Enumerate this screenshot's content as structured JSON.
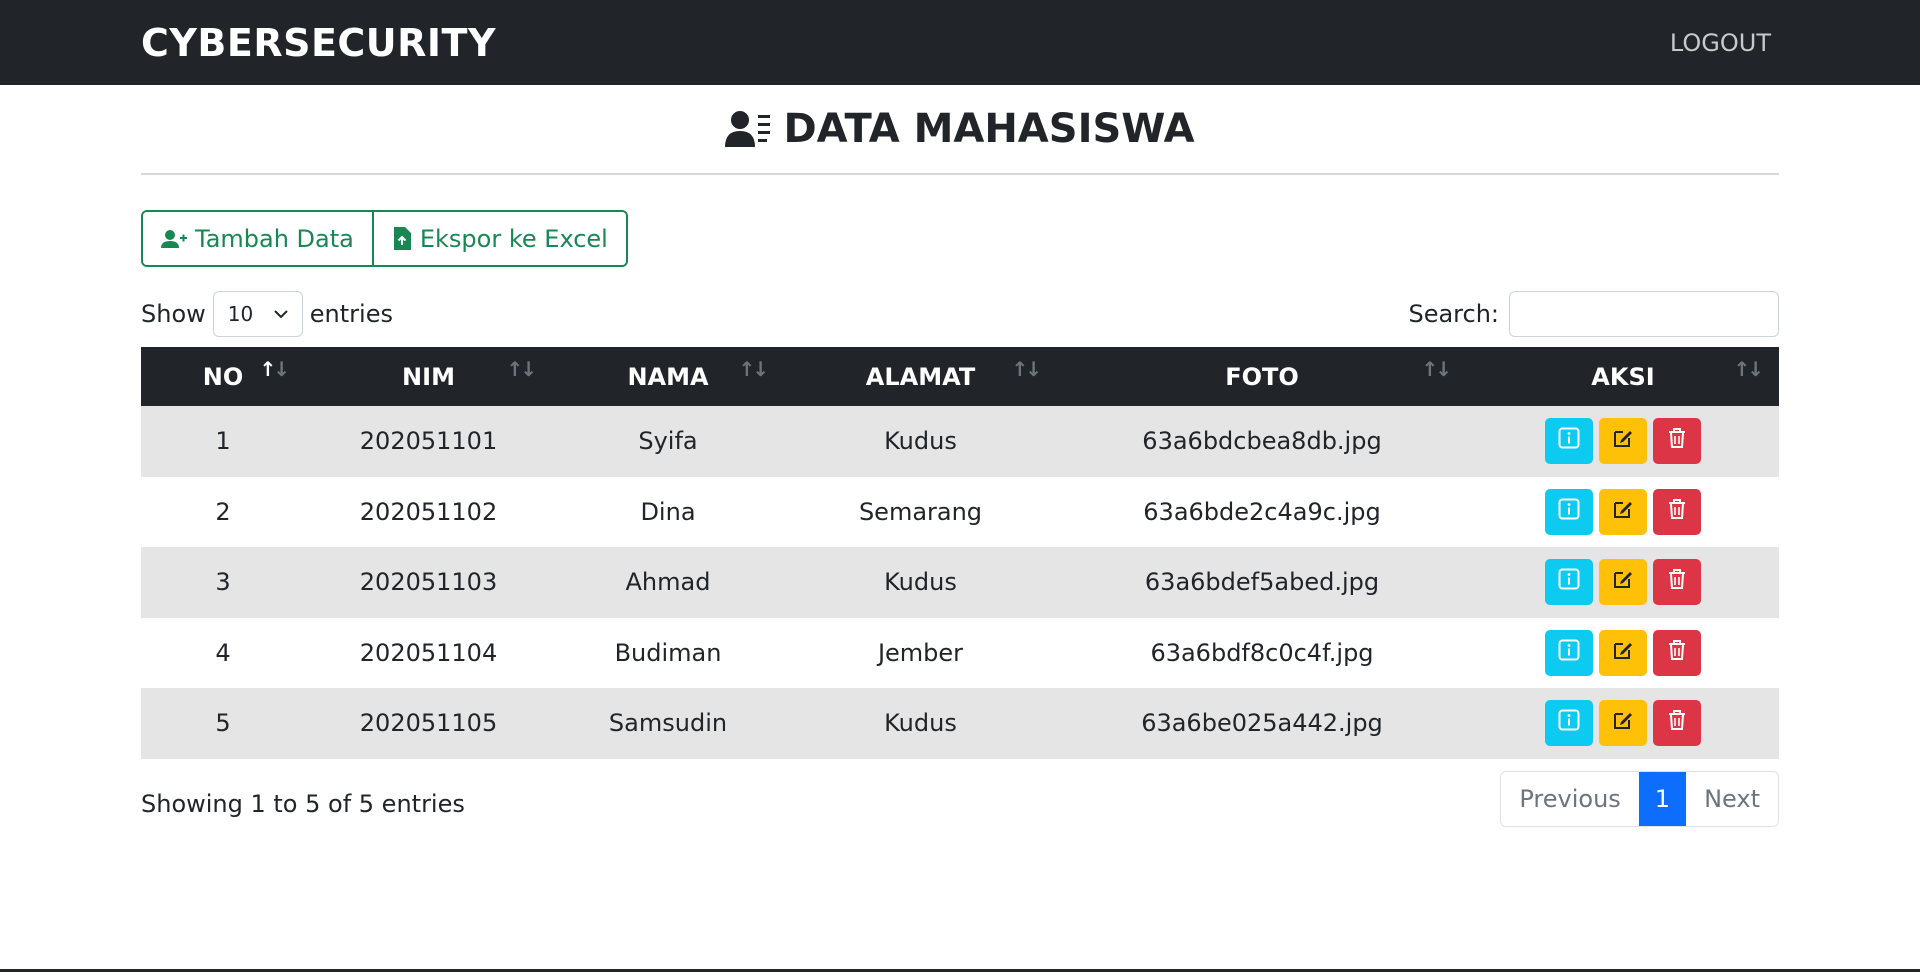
{
  "navbar": {
    "brand": "CYBERSECURITY",
    "logout": "LOGOUT"
  },
  "page": {
    "title": "DATA MAHASISWA"
  },
  "toolbar": {
    "add_label": "Tambah Data",
    "export_label": "Ekspor ke Excel"
  },
  "length": {
    "show": "Show",
    "value": "10",
    "entries": "entries"
  },
  "search": {
    "label": "Search:",
    "value": ""
  },
  "table": {
    "columns": [
      "NO",
      "NIM",
      "NAMA",
      "ALAMAT",
      "FOTO",
      "AKSI"
    ],
    "rows": [
      [
        "1",
        "202051101",
        "Syifa",
        "Kudus",
        "63a6bdcbea8db.jpg"
      ],
      [
        "2",
        "202051102",
        "Dina",
        "Semarang",
        "63a6bde2c4a9c.jpg"
      ],
      [
        "3",
        "202051103",
        "Ahmad",
        "Kudus",
        "63a6bdef5abed.jpg"
      ],
      [
        "4",
        "202051104",
        "Budiman",
        "Jember",
        "63a6bdf8c0c4f.jpg"
      ],
      [
        "5",
        "202051105",
        "Samsudin",
        "Kudus",
        "63a6be025a442.jpg"
      ]
    ]
  },
  "footer": {
    "info": "Showing 1 to 5 of 5 entries"
  },
  "pagination": {
    "previous": "Previous",
    "current": "1",
    "next": "Next"
  },
  "colors": {
    "dark": "#212529",
    "success": "#198754",
    "info": "#0dcaf0",
    "warning": "#ffc107",
    "danger": "#dc3545",
    "primary": "#0d6efd"
  }
}
